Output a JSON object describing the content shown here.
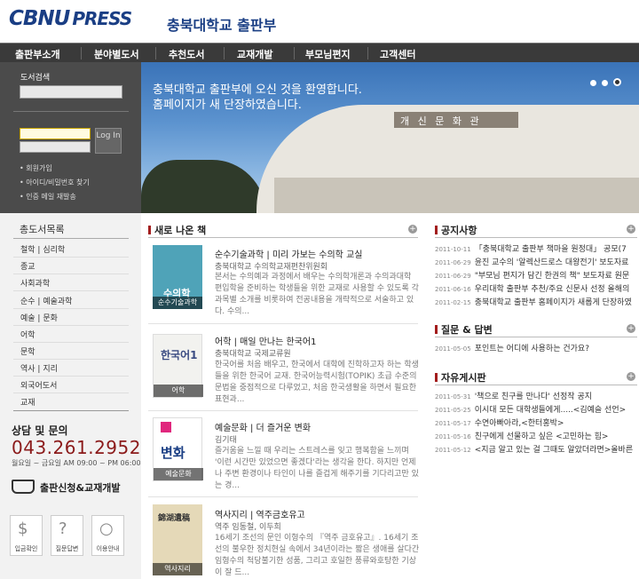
{
  "header": {
    "logo_main": "CBNU",
    "logo_press": "PRESS",
    "logo_sub": "충북대학교 출판부"
  },
  "nav": [
    "출판부소개",
    "분야별도서",
    "추천도서",
    "교재개발",
    "부모님편지",
    "고객센터"
  ],
  "login": {
    "search_label": "도서검색",
    "login_button": "Log In",
    "links": [
      "회원가입",
      "아이디/비밀번호 찾기",
      "인증 메일 재발송"
    ]
  },
  "hero": {
    "line1": "충북대학교 출판부에 오신 것을 환영합니다.",
    "line2": "홈페이지가 새 단장하였습니다.",
    "sign": "개 신 문 화 관"
  },
  "sidebar": {
    "title": "총도서목록",
    "categories": [
      "철학 | 심리학",
      "종교",
      "사회과학",
      "순수 | 예술과학",
      "예술 | 문화",
      "어학",
      "문학",
      "역사 | 지리",
      "외국어도서",
      "교재"
    ],
    "qa_title": "상담 및 문의",
    "phone": "043.261.2952",
    "hours": "월요일 ~ 금요일 AM 09:00 ~ PM 06:00",
    "apply": "출판신청&교재개발",
    "icons": [
      {
        "label": "입금확인",
        "icon": "money-bag-icon",
        "glyph": "$"
      },
      {
        "label": "질문답변",
        "icon": "question-icon",
        "glyph": "?"
      },
      {
        "label": "이용안내",
        "icon": "magnifier-icon",
        "glyph": "○"
      }
    ]
  },
  "new_books": {
    "title": "새로 나온 책",
    "items": [
      {
        "title": "순수기술과학 | 미리 가보는 수의학 교실",
        "author": "충북대학교 수의학교재편찬위원회",
        "desc": "본서는 수의예과 과정에서 배우는 수의학개론과 수의과대학 편입학을 준비하는 학생들을 위한 교재로 사용할 수 있도록 각 과목별 소개를 비롯하여 전공내용을 개략적으로 서술하고 있다. 수의...",
        "cover_title": "수의학",
        "cover_caption": "순수기술과학",
        "cover_color": "#4fa3b8"
      },
      {
        "title": "어학 | 매일 만나는 한국어1",
        "author": "충북대학교 국제교류원",
        "desc": "한국어를 처음 배우고, 한국에서 대학에 진학하고자 하는 학생들을 위한 한국어 교재. 한국어능력시험(TOPIK) 초급 수준의 문법을 중점적으로 다루었고, 처음 한국생활을 하면서 필요한 표현과...",
        "cover_title": "한국어1",
        "cover_caption": "어학",
        "cover_color": "#f2f2ef"
      },
      {
        "title": "예술문화 | 더 즐거운 변화",
        "author": "김기태",
        "desc": "즐거움을 느낄 때 우리는 스트레스를 잊고 행복함을 느끼며 '이런 시간만 있었으면 좋겠다'라는 생각을 한다. 하지만 언제나 주변 환경이나 타인이 나를 즐겁게 해주기를 기다리고만 있는 경...",
        "cover_title": "변화",
        "cover_caption": "예술문화",
        "cover_color": "#ffffff"
      },
      {
        "title": "역사지리 | 역주금호유고",
        "author": "역주 임동철, 이두희",
        "desc": "16세기 조선의 문인 이형수의 『역주 금호유고』. 16세기 조선의 불우한 정치현실 속에서 34년이라는 짧은 생애를 살다간 임형수의 척당불기한 성품, 그리고 호일한 풍류와호탕한 기상이 잘 드...",
        "cover_title": "錦湖遺稿",
        "cover_caption": "역사지리",
        "cover_color": "#e5d9b8"
      }
    ]
  },
  "notices": {
    "title": "공지사항",
    "items": [
      {
        "date": "2011-10-11",
        "text": "「충북대학교 출판부 책마을 원정대」 공모(7"
      },
      {
        "date": "2011-06-29",
        "text": "윤진 교수의 '알렉산드로스 대왕전기' 보도자료"
      },
      {
        "date": "2011-06-29",
        "text": "\"부모님 편지가 담긴 한권의 책\" 보도자료 원문"
      },
      {
        "date": "2011-06-16",
        "text": "우리대학 출판부 추천/주요 신문사 선정 올해의"
      },
      {
        "date": "2011-02-15",
        "text": "충북대학교 출판부 홈페이지가 새롭게 단장하였"
      }
    ]
  },
  "qna": {
    "title": "질문 & 답변",
    "items": [
      {
        "date": "2011-05-05",
        "text": "포인트는 어디에 사용하는 건가요?"
      }
    ]
  },
  "board": {
    "title": "자유게시판",
    "items": [
      {
        "date": "2011-05-31",
        "text": "'책으로 친구를 만나다' 선정작 공지"
      },
      {
        "date": "2011-05-25",
        "text": "이시대 모든 대학생들에게.....<김예슬 선언>"
      },
      {
        "date": "2011-05-17",
        "text": "수연아빠아라,<한터홍박>"
      },
      {
        "date": "2011-05-16",
        "text": "친구에게 선물하고 싶은 <고민하는 힘>"
      },
      {
        "date": "2011-05-12",
        "text": "<지금 알고 있는 걸 그때도 알았더라면>올바른"
      }
    ]
  },
  "colors": {
    "brand": "#1a3e84",
    "accent": "#a31d1d",
    "nav_bg": "#3a3a3a"
  }
}
